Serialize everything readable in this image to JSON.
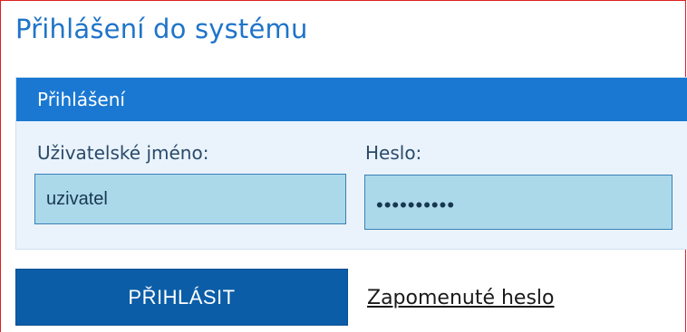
{
  "page": {
    "title": "Přihlášení do systému"
  },
  "login_panel": {
    "header": "Přihlášení",
    "username_label": "Uživatelské jméno:",
    "username_value": "uzivatel",
    "password_label": "Heslo:",
    "password_value": "heslo12345"
  },
  "actions": {
    "login_button_label": "PŘIHLÁSIT",
    "forgot_password_link": "Zapomenuté heslo"
  },
  "colors": {
    "title": "#1f74c9",
    "panel_header": "#1a78d2",
    "panel_background": "#eaf3fb",
    "input_background": "#acd9ea",
    "login_button": "#0b5da8",
    "frame_border": "#e02020"
  }
}
